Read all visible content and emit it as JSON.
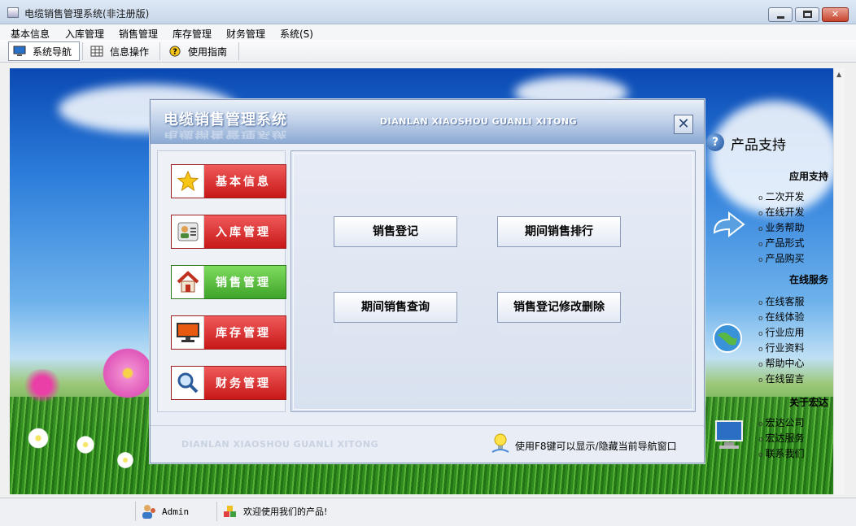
{
  "window": {
    "title": "电缆销售管理系统(非注册版)",
    "min_glyph": "",
    "max_glyph": "",
    "close_glyph": "✕"
  },
  "menubar": {
    "items": [
      "基本信息",
      "入库管理",
      "销售管理",
      "库存管理",
      "财务管理",
      "系统(S)"
    ]
  },
  "toolbar": {
    "buttons": [
      {
        "label": "系统导航",
        "icon": "monitor-icon",
        "active": true
      },
      {
        "label": "信息操作",
        "icon": "grid-icon",
        "active": false
      },
      {
        "label": "使用指南",
        "icon": "help-icon",
        "active": false
      }
    ]
  },
  "nav": {
    "title": "电缆销售管理系统",
    "subtitle": "DIANLAN XIAOSHOU GUANLI XITONG",
    "close_glyph": "✕",
    "categories": [
      {
        "label": "基本信息",
        "icon": "star-icon",
        "selected": false
      },
      {
        "label": "入库管理",
        "icon": "contacts-icon",
        "selected": false
      },
      {
        "label": "销售管理",
        "icon": "home-icon",
        "selected": true
      },
      {
        "label": "库存管理",
        "icon": "monitor-icon",
        "selected": false
      },
      {
        "label": "财务管理",
        "icon": "magnifier-icon",
        "selected": false
      }
    ],
    "functions": [
      "销售登记",
      "期间销售排行",
      "期间销售查询",
      "销售登记修改删除"
    ],
    "footer_watermark": "DIANLAN XIAOSHOU GUANLI XITONG",
    "footer_tip": "使用F8键可以显示/隐藏当前导航窗口"
  },
  "side": {
    "title": "产品支持",
    "sections": [
      {
        "heading": "应用支持",
        "links": [
          "二次开发",
          "在线开发",
          "业务帮助",
          "产品形式",
          "产品购买"
        ]
      },
      {
        "heading": "在线服务",
        "links": [
          "在线客服",
          "在线体验",
          "行业应用",
          "行业资料",
          "帮助中心",
          "在线留言"
        ]
      },
      {
        "heading": "关于宏达",
        "links": [
          "宏达公司",
          "宏达服务",
          "联系我们"
        ]
      }
    ]
  },
  "status": {
    "user": "Admin",
    "message": "欢迎使用我们的产品!"
  },
  "colors": {
    "category_red": "#d62525",
    "category_green": "#4fb236",
    "accent_blue": "#1e4f9a"
  }
}
